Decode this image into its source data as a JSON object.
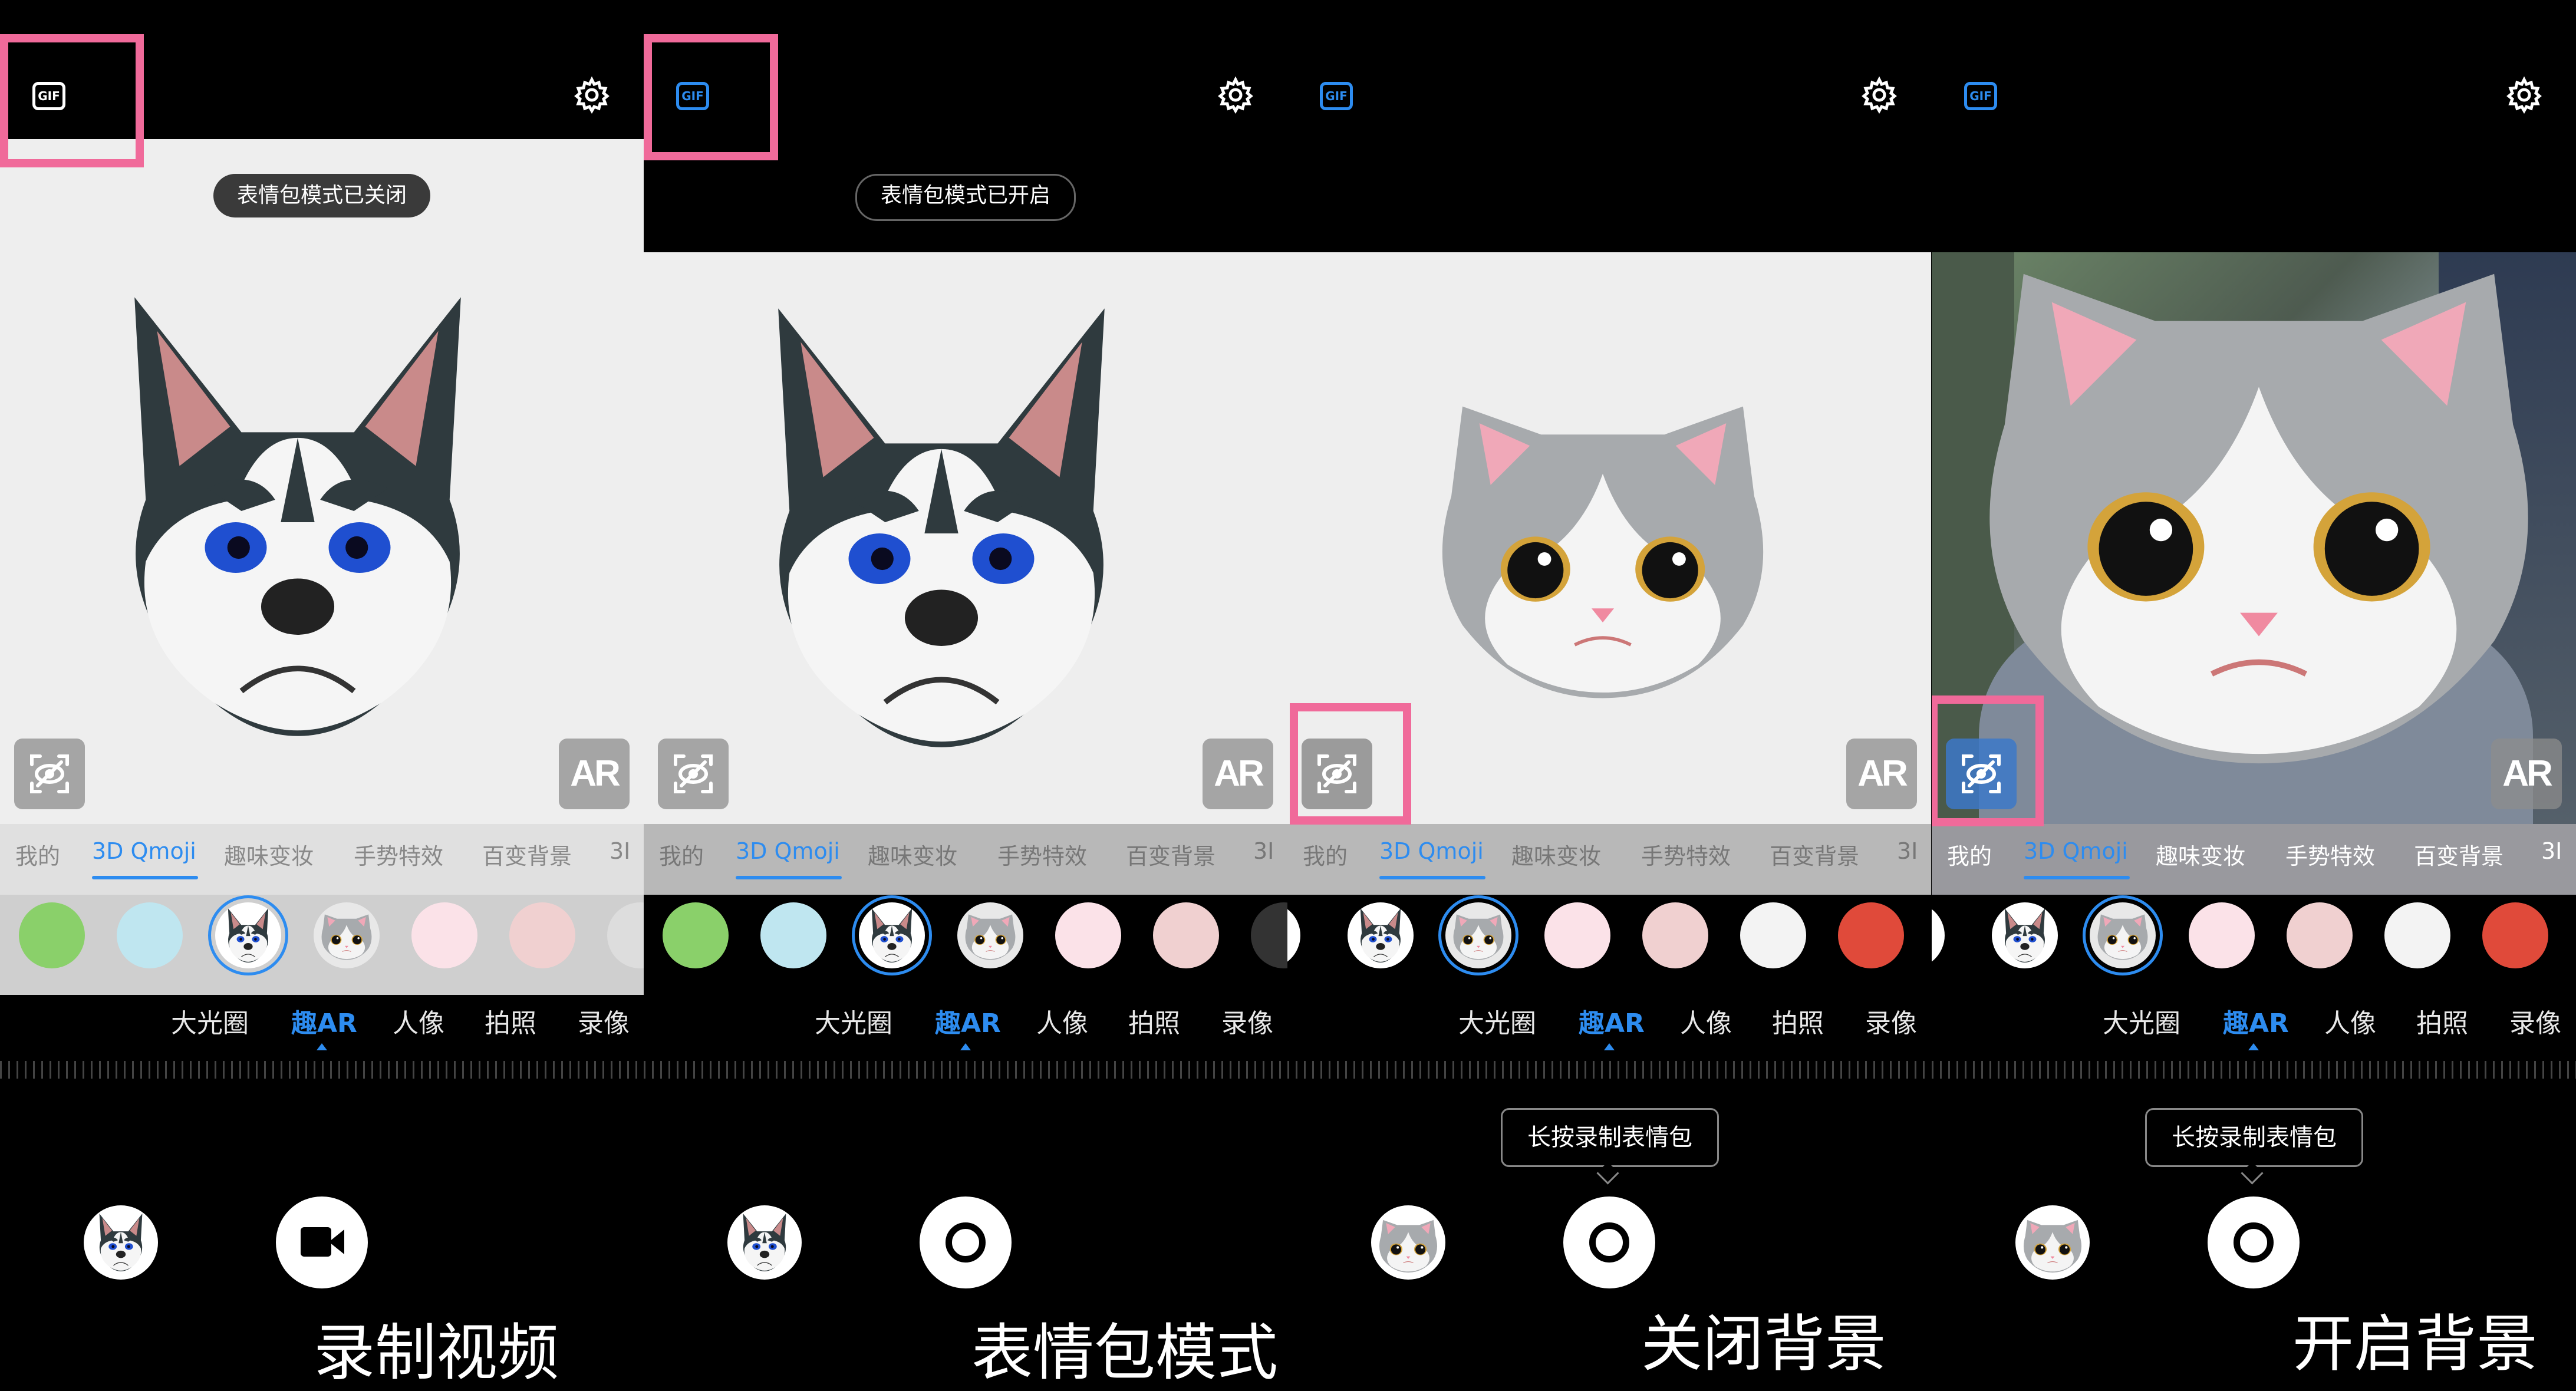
{
  "colors": {
    "accent": "#2d8cf0",
    "highlight": "#f06a9a"
  },
  "categories": [
    "我的",
    "3D Qmoji",
    "趣味变妆",
    "手势特效",
    "百变背景",
    "3I"
  ],
  "modes": [
    "大光圈",
    "趣AR",
    "人像",
    "拍照",
    "录像"
  ],
  "ar_button": "AR",
  "gif_label": "GIF",
  "panels": [
    {
      "toast": "表情包模式已关闭",
      "caption": "录制视频",
      "mask": "husky",
      "shutter": "video",
      "strip": [
        "dino",
        "fish",
        "husky",
        "cat",
        "rabbit",
        "robot",
        "more"
      ]
    },
    {
      "toast": "表情包模式已开启",
      "caption": "表情包模式",
      "mask": "husky",
      "shutter": "gif",
      "strip": [
        "dino",
        "fish",
        "husky",
        "cat",
        "rabbit",
        "robot",
        "more"
      ]
    },
    {
      "tooltip": "长按录制表情包",
      "caption": "关闭背景",
      "mask": "cat",
      "shutter": "gif",
      "background": "off",
      "strip": [
        "partial",
        "husky",
        "cat",
        "rabbit",
        "robot",
        "penguin",
        "cherry"
      ]
    },
    {
      "tooltip": "长按录制表情包",
      "caption": "开启背景",
      "mask": "cat",
      "shutter": "gif",
      "background": "on",
      "strip": [
        "partial",
        "husky",
        "cat",
        "rabbit",
        "robot",
        "penguin",
        "cherry"
      ]
    }
  ]
}
